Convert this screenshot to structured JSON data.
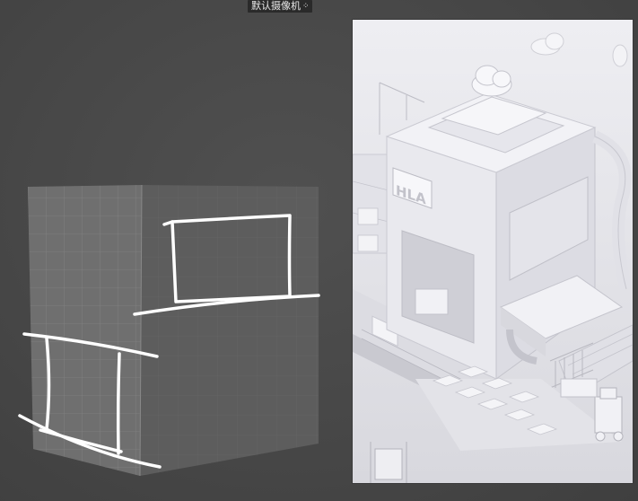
{
  "viewport": {
    "camera_label": "默认摄像机",
    "camera_icon": "camera-dots-icon"
  },
  "render": {
    "sign_text": "HLA"
  },
  "colors": {
    "viewport_bg": "#4a4a4a",
    "cube_light": "#6f6f6f",
    "cube_dark": "#5d5d5d",
    "sketch": "#ffffff",
    "render_bg": "#e6e6ea"
  }
}
